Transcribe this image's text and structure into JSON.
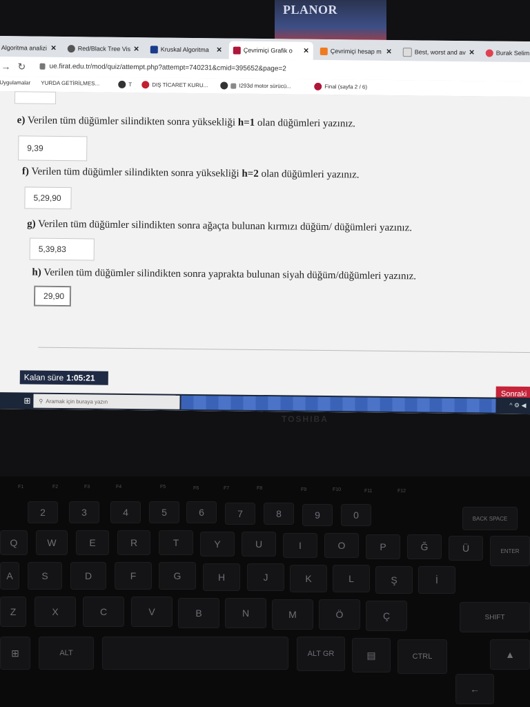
{
  "tabs": [
    {
      "label": "Algoritma analizi",
      "active": false
    },
    {
      "label": "Red/Black Tree Vis",
      "active": false
    },
    {
      "label": "Kruskal Algoritma",
      "active": false
    },
    {
      "label": "Çevrimiçi Grafik o",
      "active": true
    },
    {
      "label": "Çevrimiçi hesap m",
      "active": false
    },
    {
      "label": "Best, worst and av",
      "active": false
    },
    {
      "label": "Burak Selim",
      "active": false
    }
  ],
  "url": "ue.firat.edu.tr/mod/quiz/attempt.php?attempt=740231&cmid=395652&page=2",
  "bookmarks": [
    "Uygulamalar",
    "YURDA GETİRİLMES...",
    "T",
    "DIŞ TİCARET KURU...",
    "I293d motor sürücü...",
    "Final (sayfa 2 / 6)"
  ],
  "questions": [
    {
      "letter": "e)",
      "pre": " Verilen tüm düğümler silindikten sonra yüksekliği ",
      "bold": "h=1",
      "post": " olan düğümleri yazınız.",
      "answer": "9,39"
    },
    {
      "letter": "f)",
      "pre": " Verilen tüm düğümler silindikten sonra yüksekliği ",
      "bold": "h=2",
      "post": " olan düğümleri yazınız.",
      "answer": "5,29,90"
    },
    {
      "letter": "g)",
      "pre": " Verilen tüm düğümler silindikten sonra ağaçta bulunan kırmızı düğüm/ düğümleri yazınız.",
      "bold": "",
      "post": "",
      "answer": "5,39,83"
    },
    {
      "letter": "h)",
      "pre": " Verilen tüm düğümler silindikten sonra yaprakta bulunan siyah düğüm/düğümleri yazınız.",
      "bold": "",
      "post": "",
      "answer": "29,90"
    }
  ],
  "timer": {
    "label": "Kalan süre",
    "value": "1:05:21"
  },
  "next_button": "Sonraki",
  "taskbar_search": "Aramak için buraya yazın",
  "box_brand": "PLANOR",
  "laptop_brand": "TOSHIBA",
  "keys": {
    "row1": [
      "2",
      "3",
      "4",
      "5",
      "6",
      "7",
      "8",
      "9",
      "0"
    ],
    "row2": [
      "Q",
      "W",
      "E",
      "R",
      "T",
      "Y",
      "U",
      "I",
      "O",
      "P",
      "Ğ",
      "Ü"
    ],
    "row3": [
      "A",
      "S",
      "D",
      "F",
      "G",
      "H",
      "J",
      "K",
      "L",
      "Ş",
      "İ"
    ],
    "row4": [
      "Z",
      "X",
      "C",
      "V",
      "B",
      "N",
      "M",
      "Ö",
      "Ç"
    ],
    "backspace": "BACK SPACE",
    "enter": "ENTER",
    "shift": "SHIFT",
    "alt": "ALT",
    "altgr": "ALT GR",
    "ctrl": "CTRL"
  },
  "colors": {
    "timer_bg": "#1f2a44",
    "next_bg": "#c5243a",
    "taskbar": "#1b2638"
  }
}
